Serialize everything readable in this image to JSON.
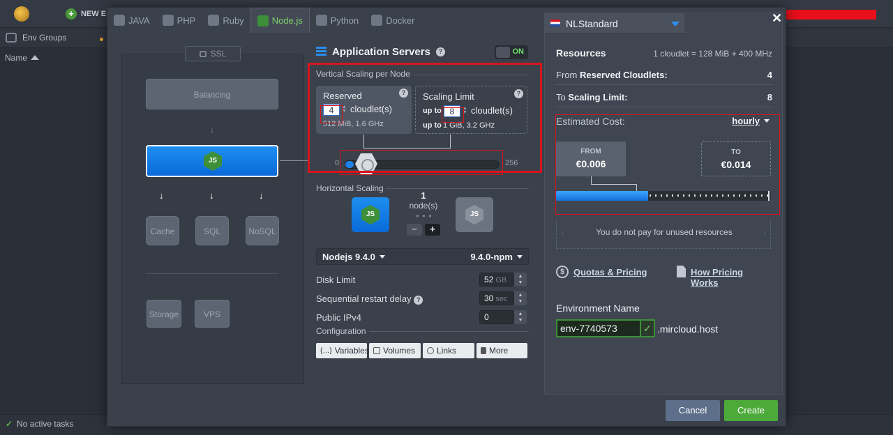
{
  "background": {
    "new_env_label": "NEW E",
    "env_groups_label": "Env Groups",
    "name_column": "Name",
    "tasks_status": "No active tasks"
  },
  "tabs": [
    {
      "label": "JAVA",
      "icon": "java-icon"
    },
    {
      "label": "PHP",
      "icon": "php-icon"
    },
    {
      "label": "Ruby",
      "icon": "ruby-icon"
    },
    {
      "label": "Node.js",
      "icon": "nodejs-icon",
      "active": true
    },
    {
      "label": "Python",
      "icon": "python-icon"
    },
    {
      "label": "Docker",
      "icon": "docker-icon"
    }
  ],
  "topology": {
    "ssl_label": "SSL",
    "balancing_label": "Balancing",
    "node_logo": "JS",
    "databases": [
      "Cache",
      "SQL",
      "NoSQL"
    ],
    "storage_label": "Storage",
    "vps_label": "VPS"
  },
  "app_servers": {
    "title": "Application Servers",
    "toggle_label": "ON",
    "vertical_scaling_title": "Vertical Scaling per Node",
    "reserved": {
      "title": "Reserved",
      "value": "4",
      "unit": "cloudlet(s)",
      "specs": "512 MiB, 1.6 GHz"
    },
    "limit": {
      "title": "Scaling Limit",
      "up_to": "up to",
      "value": "8",
      "unit": "cloudlet(s)",
      "specs_prefix": "up to",
      "specs": "1 GiB, 3.2 GHz"
    },
    "slider": {
      "min_label": "0",
      "max_label": "256",
      "min": 0,
      "max": 256,
      "reserved": 4,
      "limit": 8
    },
    "horizontal_scaling_title": "Horizontal Scaling",
    "node_count": "1",
    "node_unit": "node(s)",
    "minus_label": "−",
    "plus_label": "+",
    "engine": "Nodejs 9.4.0",
    "version": "9.4.0-npm",
    "fields": [
      {
        "label": "Disk Limit",
        "value": "52",
        "unit": "GB",
        "help": false
      },
      {
        "label": "Sequential restart delay",
        "value": "30",
        "unit": "sec",
        "help": true
      },
      {
        "label": "Public IPv4",
        "value": "0",
        "unit": "",
        "help": false
      }
    ],
    "configuration_title": "Configuration",
    "config_buttons": [
      {
        "label": "Variables",
        "icon": "variables-icon",
        "glyph": "{…}"
      },
      {
        "label": "Volumes",
        "icon": "volumes-icon",
        "glyph": ""
      },
      {
        "label": "Links",
        "icon": "links-icon",
        "glyph": ""
      },
      {
        "label": "More",
        "icon": "wrench-icon",
        "glyph": ""
      }
    ]
  },
  "region": {
    "name": "NLStandard"
  },
  "resources": {
    "title": "Resources",
    "note": "1 cloudlet = 128 MiB + 400 MHz",
    "from_prefix": "From",
    "from_label": "Reserved Cloudlets:",
    "from_value": "4",
    "to_prefix": "To",
    "to_label": "Scaling Limit:",
    "to_value": "8",
    "estimated_label": "Estimated Cost:",
    "period": "hourly",
    "from_price_label": "FROM",
    "from_price": "€0.006",
    "to_price_label": "TO",
    "to_price": "€0.014",
    "cost_fill_fraction": 0.43,
    "unused_note": "You do not pay for unused resources",
    "quotas_link": "Quotas & Pricing",
    "pricing_link": "How Pricing Works"
  },
  "environment": {
    "title": "Environment Name",
    "value": "env-7740573",
    "domain": ".mircloud.host"
  },
  "footer": {
    "cancel": "Cancel",
    "create": "Create"
  },
  "colors": {
    "accent_blue": "#1f82e6",
    "accent_green": "#4caa3a",
    "highlight_red": "#d8141e"
  }
}
